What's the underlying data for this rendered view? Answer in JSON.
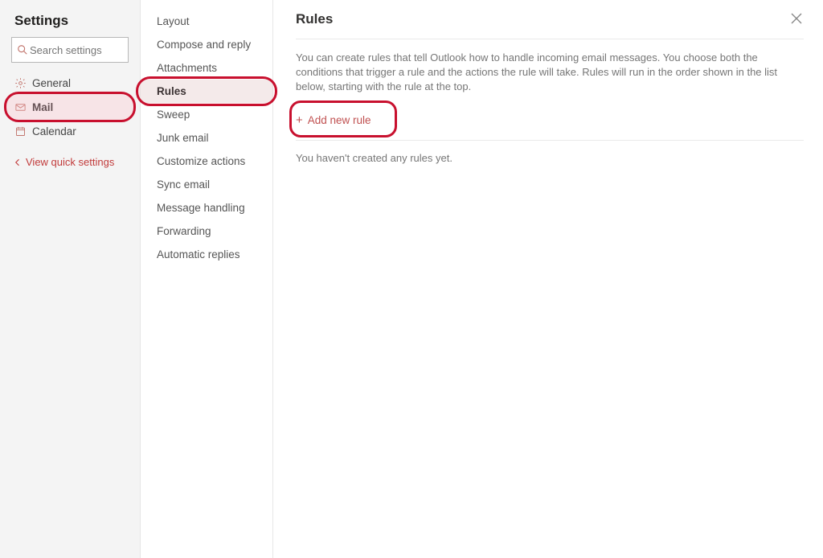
{
  "header": {
    "title": "Settings",
    "search_placeholder": "Search settings",
    "quick_link": "View quick settings"
  },
  "categories": [
    {
      "id": "general",
      "label": "General",
      "icon": "gear",
      "active": false
    },
    {
      "id": "mail",
      "label": "Mail",
      "icon": "mail",
      "active": true,
      "highlighted": true
    },
    {
      "id": "calendar",
      "label": "Calendar",
      "icon": "calendar",
      "active": false
    }
  ],
  "subnav": [
    {
      "id": "layout",
      "label": "Layout"
    },
    {
      "id": "compose",
      "label": "Compose and reply"
    },
    {
      "id": "attachments",
      "label": "Attachments"
    },
    {
      "id": "rules",
      "label": "Rules",
      "active": true,
      "highlighted": true
    },
    {
      "id": "sweep",
      "label": "Sweep"
    },
    {
      "id": "junk",
      "label": "Junk email"
    },
    {
      "id": "customize",
      "label": "Customize actions"
    },
    {
      "id": "sync",
      "label": "Sync email"
    },
    {
      "id": "mh",
      "label": "Message handling"
    },
    {
      "id": "forwarding",
      "label": "Forwarding"
    },
    {
      "id": "autoreply",
      "label": "Automatic replies"
    }
  ],
  "main": {
    "title": "Rules",
    "description": "You can create rules that tell Outlook how to handle incoming email messages. You choose both the conditions that trigger a rule and the actions the rule will take. Rules will run in the order shown in the list below, starting with the rule at the top.",
    "add_label": "Add new rule",
    "empty": "You haven't created any rules yet."
  }
}
